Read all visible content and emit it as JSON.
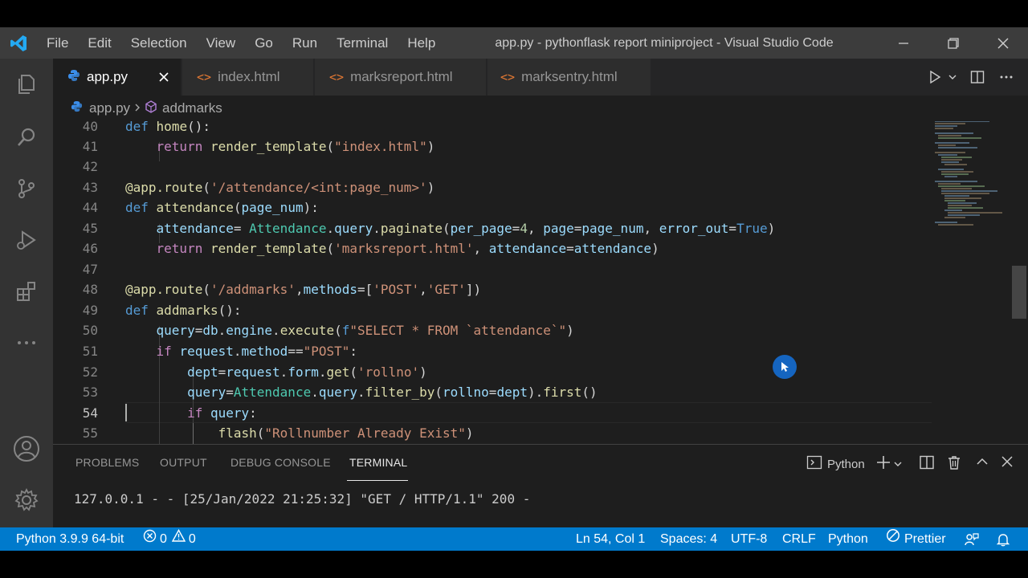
{
  "window": {
    "title": "app.py - pythonflask report miniproject - Visual Studio Code",
    "menu": [
      "File",
      "Edit",
      "Selection",
      "View",
      "Go",
      "Run",
      "Terminal",
      "Help"
    ]
  },
  "tabs": [
    {
      "label": "app.py",
      "icon": "python-icon",
      "active": true
    },
    {
      "label": "index.html",
      "icon": "html-icon",
      "active": false
    },
    {
      "label": "marksreport.html",
      "icon": "html-icon",
      "active": false
    },
    {
      "label": "marksentry.html",
      "icon": "html-icon",
      "active": false
    }
  ],
  "breadcrumb": {
    "file": "app.py",
    "symbol": "addmarks"
  },
  "editor": {
    "current_line": 54,
    "lines": [
      {
        "n": "40",
        "text": "def home():"
      },
      {
        "n": "41",
        "text": "    return render_template(\"index.html\")"
      },
      {
        "n": "42",
        "text": ""
      },
      {
        "n": "43",
        "text": "@app.route('/attendance/<int:page_num>')"
      },
      {
        "n": "44",
        "text": "def attendance(page_num):"
      },
      {
        "n": "45",
        "text": "    attendance= Attendance.query.paginate(per_page=4, page=page_num, error_out=True)"
      },
      {
        "n": "46",
        "text": "    return render_template('marksreport.html', attendance=attendance)"
      },
      {
        "n": "47",
        "text": ""
      },
      {
        "n": "48",
        "text": "@app.route('/addmarks',methods=['POST','GET'])"
      },
      {
        "n": "49",
        "text": "def addmarks():"
      },
      {
        "n": "50",
        "text": "    query=db.engine.execute(f\"SELECT * FROM `attendance`\")"
      },
      {
        "n": "51",
        "text": "    if request.method==\"POST\":"
      },
      {
        "n": "52",
        "text": "        dept=request.form.get('rollno')"
      },
      {
        "n": "53",
        "text": "        query=Attendance.query.filter_by(rollno=dept).first()"
      },
      {
        "n": "54",
        "text": "        if query:"
      },
      {
        "n": "55",
        "text": "            flash(\"Rollnumber Already Exist\")"
      }
    ]
  },
  "panel": {
    "tabs": [
      "PROBLEMS",
      "OUTPUT",
      "DEBUG CONSOLE",
      "TERMINAL"
    ],
    "active_tab": "TERMINAL",
    "terminal_shell": "Python",
    "terminal_output": "127.0.0.1 - - [25/Jan/2022 21:25:32] \"GET / HTTP/1.1\" 200 -"
  },
  "statusbar": {
    "interpreter": "Python 3.9.9 64-bit",
    "errors": "0",
    "warnings": "0",
    "position": "Ln 54, Col 1",
    "spaces": "Spaces: 4",
    "encoding": "UTF-8",
    "eol": "CRLF",
    "language": "Python",
    "formatter": "Prettier"
  },
  "colors": {
    "accent": "#007acc",
    "titlebar": "#3c3c3c",
    "activitybar": "#333333",
    "editor_bg": "#1e1e1e",
    "python_icon": "#3b8eea",
    "html_icon": "#e37933"
  }
}
